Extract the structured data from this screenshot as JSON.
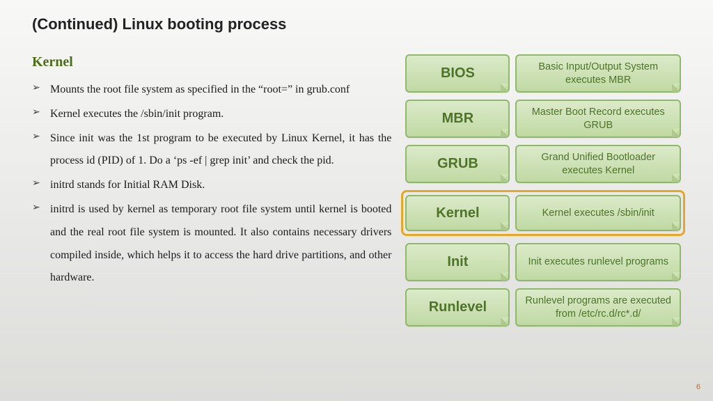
{
  "title": "(Continued) Linux booting process",
  "subhead": "Kernel",
  "bullets": [
    "Mounts the root file system as specified in the “root=” in grub.conf",
    "Kernel executes the /sbin/init program.",
    "Since init was the 1st program to be executed by Linux Kernel, it has the process id (PID) of 1. Do a ‘ps -ef | grep init’ and check the pid.",
    "initrd stands for Initial RAM Disk.",
    "initrd is used by kernel as temporary root file system until kernel is booted and the real root file system is mounted. It also contains necessary drivers compiled inside, which helps it to access the hard drive partitions, and other hardware."
  ],
  "diagram": [
    {
      "short": "BIOS",
      "long": "Basic Input/Output System executes MBR",
      "highlight": false
    },
    {
      "short": "MBR",
      "long": "Master Boot Record executes GRUB",
      "highlight": false
    },
    {
      "short": "GRUB",
      "long": "Grand Unified Bootloader executes Kernel",
      "highlight": false
    },
    {
      "short": "Kernel",
      "long": "Kernel executes /sbin/init",
      "highlight": true
    },
    {
      "short": "Init",
      "long": "Init executes runlevel programs",
      "highlight": false
    },
    {
      "short": "Runlevel",
      "long": "Runlevel programs are executed from /etc/rc.d/rc*.d/",
      "highlight": false
    }
  ],
  "page_number": "6"
}
